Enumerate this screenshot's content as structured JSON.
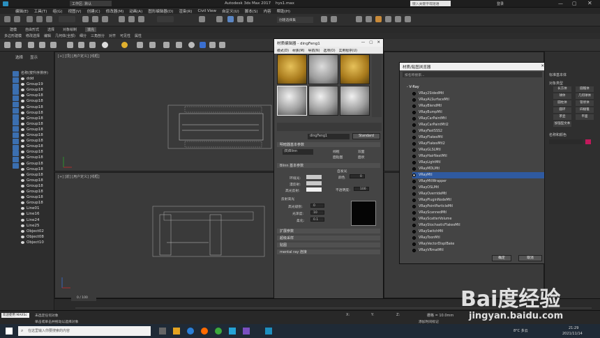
{
  "title": {
    "workspace": "工作区: 默认",
    "app": "Autodesk 3ds Max 2017",
    "file": "hys1.max",
    "search": "键入关键字或短语",
    "user": "登录"
  },
  "menu": [
    "编辑(E)",
    "工具(T)",
    "组(G)",
    "视图(V)",
    "创建(C)",
    "修改器(M)",
    "动画(A)",
    "图形编辑器(D)",
    "渲染(R)",
    "Civil View",
    "自定义(U)",
    "脚本(S)",
    "内容",
    "帮助(H)"
  ],
  "selection_set": "创建选择集",
  "ribbon": [
    "建模",
    "自由形式",
    "选择",
    "对象绘制",
    "填充"
  ],
  "ribbon2": [
    "多边形建模",
    "修改选择",
    "编辑",
    "几何体(全部)",
    "细分",
    "三角剖分",
    "对齐",
    "可见性",
    "属性"
  ],
  "scene": {
    "tabs": [
      "选择",
      "显示"
    ],
    "header": "名称(按升序排序)",
    "rows": [
      "ddd",
      "Group19",
      "Group18",
      "Group18",
      "Group18",
      "Group18",
      "Group18",
      "Group18",
      "Group18",
      "Group18",
      "Group18",
      "Group18",
      "Group18",
      "Group18",
      "Group18",
      "Group18",
      "Group18",
      "Group18",
      "Group18",
      "Group18",
      "Group18",
      "Group18",
      "Group18",
      "Line01",
      "Line16",
      "Line24",
      "Line25",
      "Object02",
      "Object08",
      "Object10"
    ]
  },
  "viewports": {
    "top": "[+] [顶] [用户定义] [线框]",
    "front": "[+] [前] [用户定义] [线框]"
  },
  "mat_editor": {
    "title": "材质编辑器 - dingFeng1",
    "menu": [
      "模式(D)",
      "材质(M)",
      "导航(N)",
      "选项(O)",
      "实用程序(U)"
    ],
    "name": "dingFeng1",
    "type": "Standard",
    "basic_rollup": "明暗器基本参数",
    "shader": "(B)Blinn",
    "wire": "线框",
    "two_sided": "双面",
    "face_map": "面贴图",
    "faceted": "面状",
    "blinn_rollup": "Blinn 基本参数",
    "ambient": "环境光:",
    "diffuse": "漫反射:",
    "specular": "高光反射:",
    "self_illum": "自发光",
    "color": "颜色",
    "color_val": "0",
    "opacity": "不透明度:",
    "opacity_val": "100",
    "spec_hl": "反射高光",
    "spec_level": "高光级别:",
    "spec_level_val": "0",
    "gloss": "光泽度:",
    "gloss_val": "10",
    "soften": "柔化:",
    "soften_val": "0.1",
    "r1": "扩展参数",
    "r2": "超级采样",
    "r3": "贴图",
    "r4": "mental ray 连接"
  },
  "browser": {
    "title": "材质/贴图浏览器",
    "search": "按名称搜索...",
    "group": "- V-Ray",
    "items": [
      "VRay2SidedMtl",
      "VRayALSurfaceMtl",
      "VRayBlendMtl",
      "VRayBumpMtl",
      "VRayCarPaintMtl",
      "VRayCarPaintMtl2",
      "VRayFastSSS2",
      "VRayFlakesMtl",
      "VRayFlakesMtl2",
      "VRayGLSLMtl",
      "VRayHairNextMtl",
      "VRayLightMtl",
      "VRayMDLMtl",
      "VRayMtl",
      "VRayMtlWrapper",
      "VRayOSLMtl",
      "VRayOverrideMtl",
      "VRayPluginNodeMtl",
      "VRayPointParticleMtl",
      "VRayScannedMtl",
      "VRayScatterVolume",
      "VRayStochasticFlakesMtl",
      "VRaySwitchMtl",
      "VRayToonMtl",
      "VRayVectorDisplBake",
      "VRayVRmatMtl"
    ],
    "selected": "VRayMtl",
    "ok": "确定",
    "cancel": "取消"
  },
  "cmd": {
    "header": "标准基本体",
    "type_header": "对象类型",
    "btns": [
      "长方体",
      "圆锥体",
      "球体",
      "几何球体",
      "圆柱体",
      "管状体",
      "圆环",
      "四棱锥",
      "茶壶",
      "平面",
      "加强型文本"
    ],
    "name_header": "名称和颜色",
    "accent": "#c2185b"
  },
  "timeline": {
    "frame": "0 / 100"
  },
  "status": {
    "sel": "未选定任何对象",
    "hint": "单击或单击并拖动以选择对象",
    "welcome": "欢迎使用 MAXSc",
    "x": "X:",
    "y": "Y:",
    "z": "Z:",
    "grid": "栅格 = 10.0mm",
    "add_time": "添加时间标记"
  },
  "taskbar": {
    "search": "在这里输入你要搜索的内容",
    "weather": "8°C 多云",
    "time": "21:29",
    "date": "2021/11/14"
  },
  "watermark": {
    "brand": "Bai度经验",
    "url": "jingyan.baidu.com"
  }
}
